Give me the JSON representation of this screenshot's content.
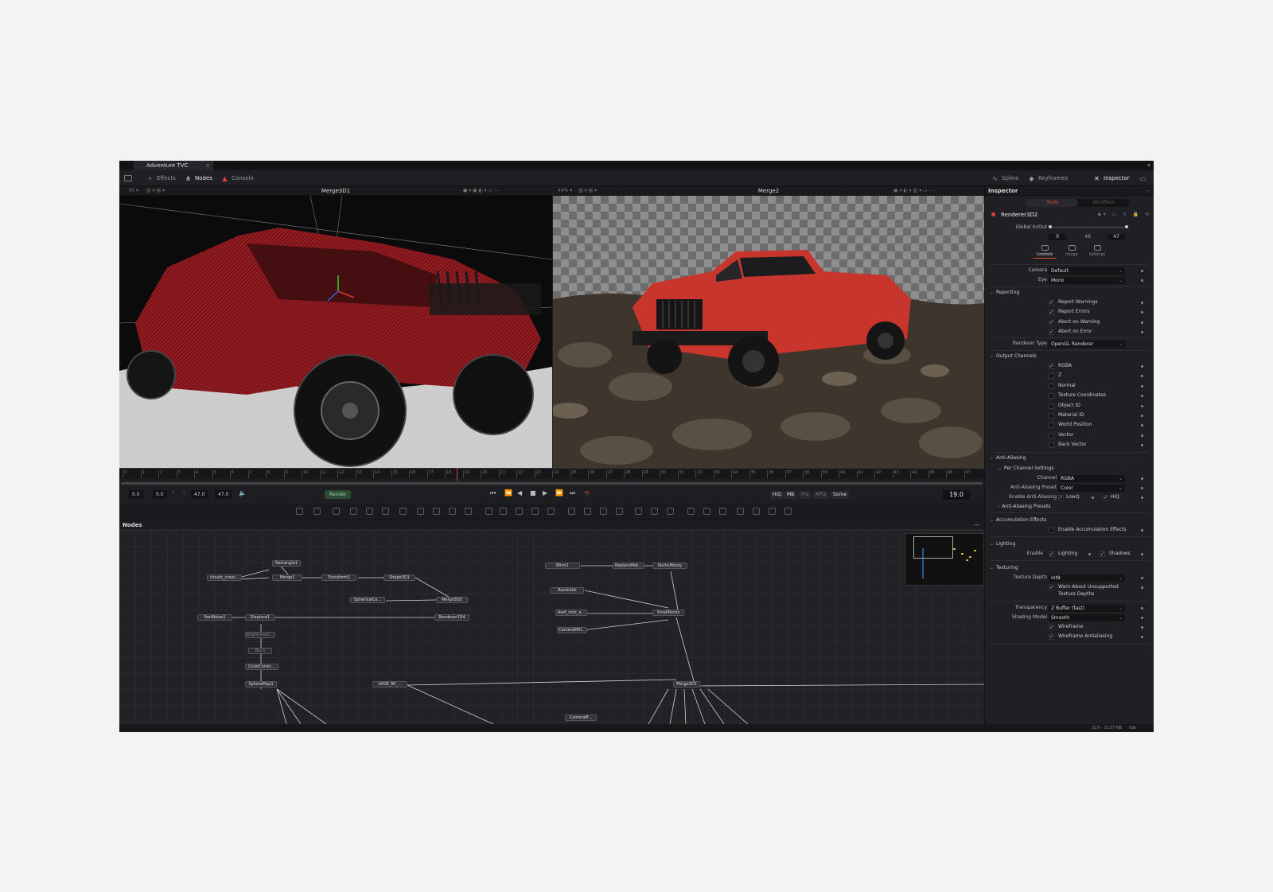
{
  "window": {
    "tab_title": "Adventure TVC",
    "close_glyph": "×"
  },
  "toolbar": {
    "effects": "Effects",
    "nodes": "Nodes",
    "console": "Console",
    "spline": "Spline",
    "keyframes": "Keyframes",
    "inspector": "Inspector"
  },
  "viewers": {
    "left": {
      "title": "Merge3D1",
      "fit": "Fit"
    },
    "right": {
      "title": "Merge2",
      "zoom": "44%"
    }
  },
  "ruler": {
    "ticks": [
      "0",
      "1",
      "2",
      "3",
      "4",
      "5",
      "6",
      "7",
      "8",
      "9",
      "10",
      "11",
      "12",
      "13",
      "14",
      "15",
      "16",
      "17",
      "18",
      "19",
      "20",
      "21",
      "22",
      "23",
      "24",
      "25",
      "26",
      "27",
      "28",
      "29",
      "30",
      "31",
      "32",
      "33",
      "34",
      "35",
      "36",
      "37",
      "38",
      "39",
      "40",
      "41",
      "42",
      "43",
      "44",
      "45",
      "46",
      "47"
    ]
  },
  "transport": {
    "start": "0.0",
    "render_start": "0.0",
    "render_end": "47.0",
    "end": "47.0",
    "render_label": "Render",
    "current_frame": "19.0",
    "hiq": "HiQ",
    "mb": "MB",
    "prx": "Prx",
    "aprx": "APrx",
    "some": "Some"
  },
  "nodes_panel": {
    "title": "Nodes",
    "nodes": [
      "Rectangle1",
      "clouds_creat...",
      "Merge1",
      "Transform1",
      "Shape3D1",
      "SphericalCa...",
      "Merge3D2",
      "FastNoise1",
      "Displace1",
      "Renderer3D4",
      "BrightnessC...",
      "Blur1",
      "ColorCorrec...",
      "SphereMap1",
      "sRGB_8K_...",
      "Blinn1",
      "ReplaceMat...",
      "RocksMossy",
      "Rockkkkk",
      "Aset_rock_a...",
      "SmallRocks",
      "CameraMAI...",
      "Merge3D1",
      "CameraM..."
    ]
  },
  "status": {
    "memory": "31% - 5137 MB",
    "state": "Idle"
  },
  "inspector": {
    "title": "Inspector",
    "tabs": {
      "tools": "Tools",
      "modifiers": "Modifiers"
    },
    "tool_name": "Renderer3D2",
    "global_inout": {
      "label": "Global In/Out",
      "in": "0",
      "mid": "48",
      "out": "47"
    },
    "icon_tabs": {
      "controls": "Controls",
      "image": "Image",
      "settings": "Settings"
    },
    "camera": {
      "label": "Camera",
      "value": "Default"
    },
    "eye": {
      "label": "Eye",
      "value": "Mono"
    },
    "reporting": {
      "section": "Reporting",
      "items": [
        "Report Warnings",
        "Report Errors",
        "Abort on Warning",
        "Abort on Error"
      ]
    },
    "renderer_type": {
      "label": "Renderer Type",
      "value": "OpenGL Renderer"
    },
    "output_channels": {
      "section": "Output Channels",
      "items": [
        "RGBA",
        "Z",
        "Normal",
        "Texture Coordinates",
        "Object ID",
        "Material ID",
        "World Position",
        "Vector",
        "Back Vector"
      ]
    },
    "anti_aliasing": {
      "section": "Anti-Aliasing",
      "per_channel": "Per Channel Settings",
      "channel": {
        "label": "Channel",
        "value": "RGBA"
      },
      "preset": {
        "label": "Anti-Aliasing Preset",
        "value": "Color"
      },
      "enable_label": "Enable Anti-Aliasing",
      "lowq": "LowQ",
      "hiq": "HiQ",
      "presets": "Anti-Aliasing Presets"
    },
    "accumulation": {
      "section": "Accumulation Effects",
      "enable": "Enable Accumulation Effects"
    },
    "lighting": {
      "section": "Lighting",
      "enable_label": "Enable",
      "lighting": "Lighting",
      "shadows": "Shadows"
    },
    "texturing": {
      "section": "Texturing",
      "depth": {
        "label": "Texture Depth",
        "value": "int8"
      },
      "warn": "Warn About Unsupported",
      "warn2": "Texture Depths"
    },
    "transparency": {
      "label": "Transparency",
      "value": "Z Buffer (fast)"
    },
    "shading": {
      "label": "Shading Model",
      "value": "Smooth"
    },
    "wireframe": "Wireframe",
    "wireframe_aa": "Wireframe Antialiasing"
  }
}
